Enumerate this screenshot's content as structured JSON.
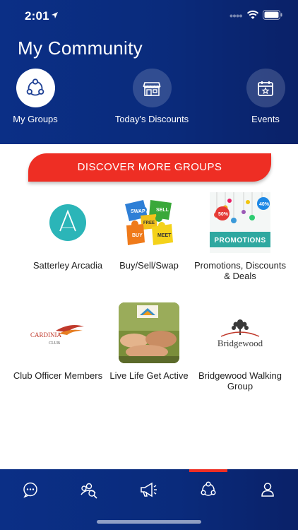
{
  "status": {
    "time": "2:01"
  },
  "header": {
    "title": "My Community"
  },
  "top_nav": [
    {
      "label": "My Groups",
      "icon": "groups-icon",
      "active": true
    },
    {
      "label": "Today's Discounts",
      "icon": "store-icon",
      "active": false
    },
    {
      "label": "Events",
      "icon": "calendar-star-icon",
      "active": false
    }
  ],
  "discover_button": "DISCOVER MORE GROUPS",
  "groups": [
    {
      "label": "Satterley Arcadia",
      "icon": "arcadia-logo"
    },
    {
      "label": "Buy/Sell/Swap",
      "icon": "puzzle-icon",
      "puzzle_words": [
        "SWAP",
        "SELL",
        "FREE",
        "BUY",
        "MEET"
      ]
    },
    {
      "label": "Promotions, Discounts & Deals",
      "icon": "promotions-icon",
      "banner": "PROMOTIONS",
      "tags": [
        "50%",
        "40%"
      ]
    },
    {
      "label": "Club Officer Members",
      "icon": "cardinia-club-logo",
      "logo_text": [
        "CARDINIA",
        "CLUB"
      ]
    },
    {
      "label": "Live Life Get Active",
      "icon": "live-life-photo"
    },
    {
      "label": "Bridgewood Walking Group",
      "icon": "bridgewood-logo",
      "logo_text": "Bridgewood"
    }
  ],
  "bottom_nav": [
    {
      "icon": "chat-icon"
    },
    {
      "icon": "community-search-icon"
    },
    {
      "icon": "megaphone-icon"
    },
    {
      "icon": "groups-icon",
      "active": true
    },
    {
      "icon": "profile-icon"
    }
  ],
  "colors": {
    "header": "#0b2f86",
    "accent": "#ee2e24",
    "text": "#222222"
  }
}
